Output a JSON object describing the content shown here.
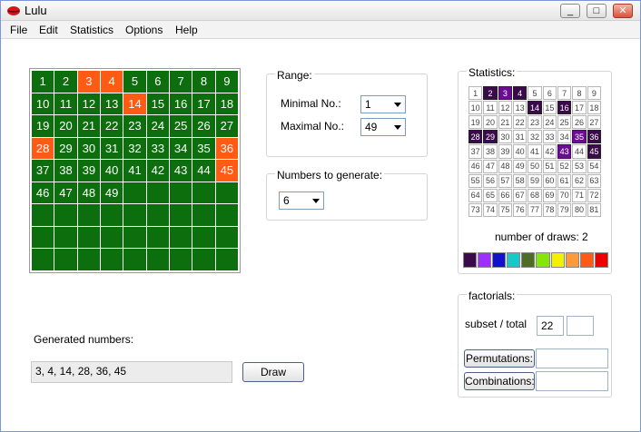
{
  "window": {
    "title": "Lulu"
  },
  "titlebar_buttons": {
    "minimize": "_",
    "maximize": "□",
    "close": "✕"
  },
  "menu": {
    "file": "File",
    "edit": "Edit",
    "statistics": "Statistics",
    "options": "Options",
    "help": "Help"
  },
  "number_grid": {
    "numbers": [
      1,
      2,
      3,
      4,
      5,
      6,
      7,
      8,
      9,
      10,
      11,
      12,
      13,
      14,
      15,
      16,
      17,
      18,
      19,
      20,
      21,
      22,
      23,
      24,
      25,
      26,
      27,
      28,
      29,
      30,
      31,
      32,
      33,
      34,
      35,
      36,
      37,
      38,
      39,
      40,
      41,
      42,
      43,
      44,
      45,
      46,
      47,
      48,
      49
    ],
    "selected": [
      3,
      4,
      14,
      28,
      36,
      45
    ],
    "rows": 9,
    "cols": 9,
    "cell_color": "#0c6e0c",
    "selected_color": "#ff5b14"
  },
  "range": {
    "label": "Range:",
    "min_label": "Minimal No.:",
    "min_value": "1",
    "max_label": "Maximal No.:",
    "max_value": "49"
  },
  "generate": {
    "label": "Numbers to generate:",
    "value": "6"
  },
  "statistics": {
    "label": "Statistics:",
    "numbers": [
      1,
      2,
      3,
      4,
      5,
      6,
      7,
      8,
      9,
      10,
      11,
      12,
      13,
      14,
      15,
      16,
      17,
      18,
      19,
      20,
      21,
      22,
      23,
      24,
      25,
      26,
      27,
      28,
      29,
      30,
      31,
      32,
      33,
      34,
      35,
      36,
      37,
      38,
      39,
      40,
      41,
      42,
      43,
      44,
      45,
      46,
      47,
      48,
      49,
      50,
      51,
      52,
      53,
      54,
      55,
      56,
      57,
      58,
      59,
      60,
      61,
      62,
      63,
      64,
      65,
      66,
      67,
      68,
      69,
      70,
      71,
      72,
      73,
      74,
      75,
      76,
      77,
      78,
      79,
      80,
      81
    ],
    "drawn_once": [
      2,
      3,
      4,
      14,
      16,
      35,
      28,
      29,
      36,
      43,
      45
    ],
    "drawn_twice": [
      2,
      4,
      14,
      16,
      28,
      29,
      36,
      45
    ],
    "draws_text": "number of draws: 2",
    "palette": [
      "#3a0a4a",
      "#9b30ff",
      "#1212c8",
      "#19c8c8",
      "#4e6b2a",
      "#86e60c",
      "#f2f200",
      "#ff9a3a",
      "#ff5b14",
      "#ee0000"
    ]
  },
  "factorials": {
    "label": "factorials:",
    "subset_label": "subset / total",
    "subset_value": "22",
    "total_value": "",
    "permutations_label": "Permutations:",
    "permutations_value": "",
    "combinations_label": "Combinations:",
    "combinations_value": ""
  },
  "generated": {
    "label": "Generated numbers:",
    "value": "3, 4, 14, 28, 36, 45",
    "draw_button": "Draw"
  }
}
